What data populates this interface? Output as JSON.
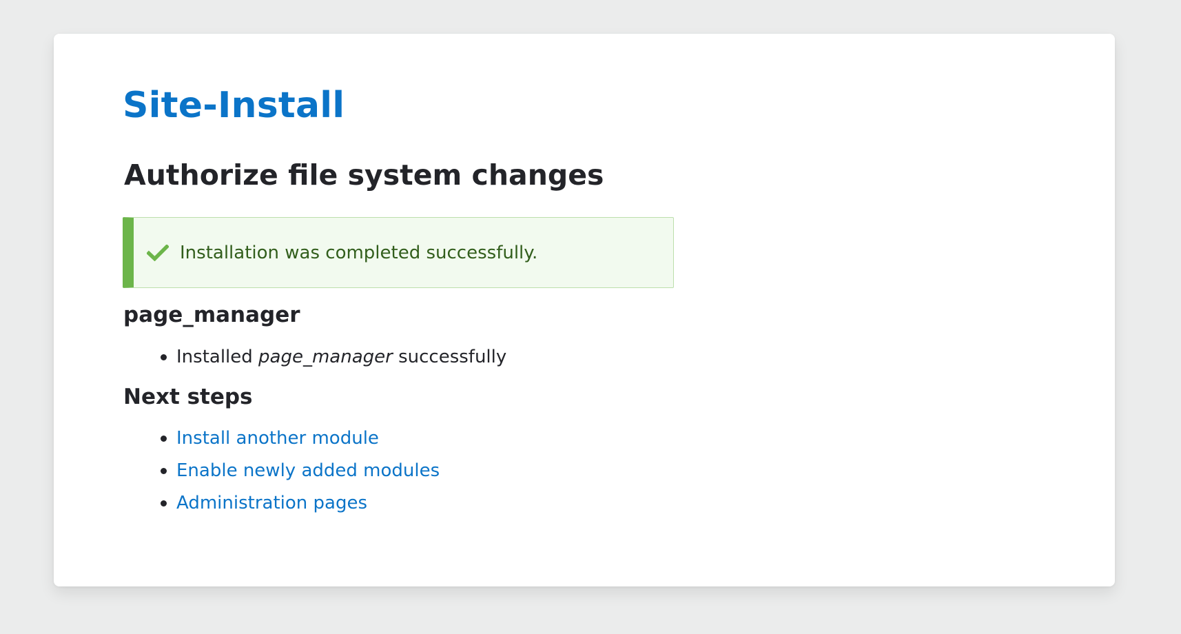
{
  "page": {
    "site_title": "Site-Install",
    "heading": "Authorize file system changes"
  },
  "status": {
    "icon": "check-icon",
    "message": "Installation was completed successfully.",
    "accent_color": "#6cb54a",
    "text_color": "#325e1c"
  },
  "module": {
    "name": "page_manager",
    "result_prefix": "Installed ",
    "result_module": "page_manager",
    "result_suffix": " successfully"
  },
  "next_steps": {
    "heading": "Next steps",
    "links": [
      "Install another module",
      "Enable newly added modules",
      "Administration pages"
    ]
  },
  "colors": {
    "link": "#0b74c8",
    "background": "#ebecec"
  }
}
